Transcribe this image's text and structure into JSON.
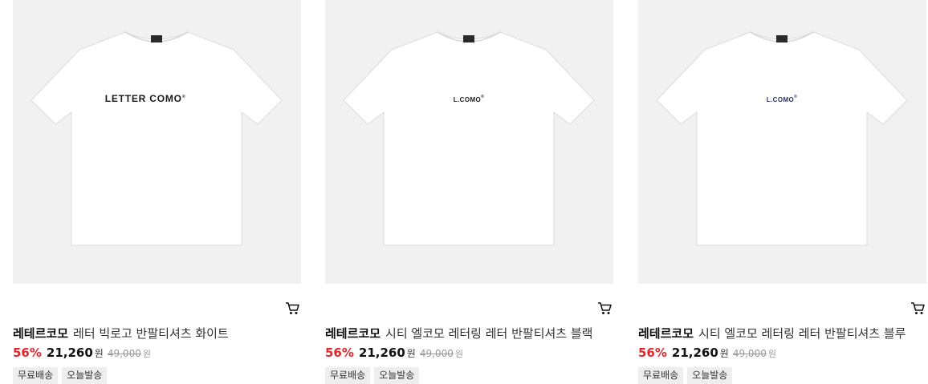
{
  "products": [
    {
      "brand": "레테르코모",
      "name": "레터 빅로고 반팔티셔츠 화이트",
      "print": "LETTER COMO",
      "print_mark": "®",
      "print_color": "#1a1a1a",
      "discount": "56%",
      "sale_price": "21,260",
      "currency": "원",
      "original_price": "49,000",
      "tags": [
        "무료배송",
        "오늘발송"
      ],
      "cart_icon": "cart-icon"
    },
    {
      "brand": "레테르코모",
      "name": "시티 엘코모 레터링 레터 반팔티셔츠 블랙",
      "print": "L.COMO",
      "print_mark": "®",
      "print_color": "#1a1a1a",
      "discount": "56%",
      "sale_price": "21,260",
      "currency": "원",
      "original_price": "49,000",
      "tags": [
        "무료배송",
        "오늘발송"
      ],
      "cart_icon": "cart-icon"
    },
    {
      "brand": "레테르코모",
      "name": "시티 엘코모 레터링 레터 반팔티셔츠 블루",
      "print": "L.COMO",
      "print_mark": "®",
      "print_color": "#2a2f6a",
      "discount": "56%",
      "sale_price": "21,260",
      "currency": "원",
      "original_price": "49,000",
      "tags": [
        "무료배송",
        "오늘발송"
      ],
      "cart_icon": "cart-icon"
    }
  ],
  "colors": {
    "discount": "#e0262a",
    "thumb_bg": "#f1f1f1",
    "tag_bg": "#eeeeee"
  }
}
